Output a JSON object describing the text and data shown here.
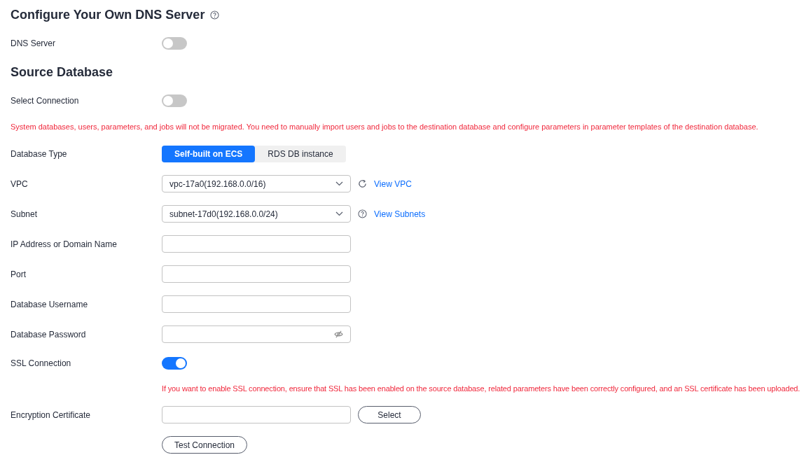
{
  "sections": [
    {
      "title": "Configure Your Own DNS Server",
      "help": true,
      "rows": [
        {
          "kind": "toggle",
          "label": "DNS Server",
          "on": false
        }
      ]
    },
    {
      "title": "Source Database",
      "help": false,
      "rows": [
        {
          "kind": "toggle",
          "label": "Select Connection",
          "on": false
        },
        {
          "kind": "notice",
          "text": "System databases, users, parameters, and jobs will not be migrated. You need to manually import users and jobs to the destination database and configure parameters in parameter templates of the destination database."
        },
        {
          "kind": "segmented",
          "label": "Database Type",
          "options": [
            {
              "label": "Self-built on ECS",
              "selected": true
            },
            {
              "label": "RDS DB instance",
              "selected": false
            }
          ]
        },
        {
          "kind": "select",
          "label": "VPC",
          "value": "vpc-17a0(192.168.0.0/16)",
          "action": {
            "kind": "refresh",
            "link": "View VPC"
          }
        },
        {
          "kind": "select",
          "label": "Subnet",
          "value": "subnet-17d0(192.168.0.0/24)",
          "action": {
            "kind": "help",
            "link": "View Subnets"
          }
        },
        {
          "kind": "input",
          "label": "IP Address or Domain Name"
        },
        {
          "kind": "input",
          "label": "Port"
        },
        {
          "kind": "input",
          "label": "Database Username"
        },
        {
          "kind": "password",
          "label": "Database Password"
        },
        {
          "kind": "toggle",
          "label": "SSL Connection",
          "on": true,
          "hint": "If you want to enable SSL connection, ensure that SSL has been enabled on the source database, related parameters have been correctly configured, and an SSL certificate has been uploaded."
        },
        {
          "kind": "file",
          "label": "Encryption Certificate",
          "button": "Select"
        },
        {
          "kind": "button",
          "button": "Test Connection"
        }
      ]
    }
  ]
}
